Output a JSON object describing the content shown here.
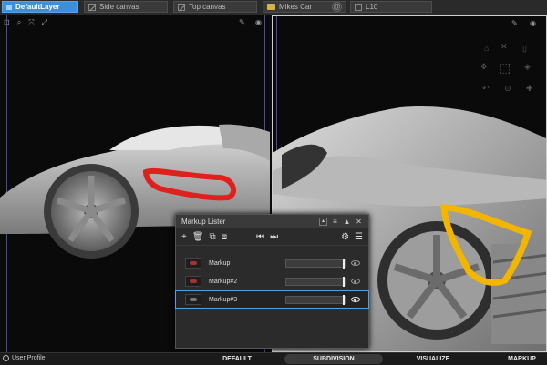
{
  "layers": [
    {
      "label": "DefaultLayer",
      "active": true,
      "icon": "layer-swatch-icon"
    },
    {
      "label": "Side canvas",
      "active": false,
      "icon": "hidden-checkbox-icon"
    },
    {
      "label": "Top canvas",
      "active": false,
      "icon": "hidden-checkbox-icon"
    },
    {
      "label": "Mikes Car",
      "active": false,
      "icon": "folder-icon"
    },
    {
      "label": "L10",
      "active": false,
      "icon": "checkbox-icon"
    }
  ],
  "viewport_icons": [
    "new-view-icon",
    "zoom-icon",
    "fit-icon",
    "expand-icon"
  ],
  "markup_lister": {
    "title": "Markup Lister",
    "toolbar": [
      "add-icon",
      "delete-icon",
      "duplicate-icon",
      "merge-icon",
      "first-icon",
      "last-icon",
      "settings-icon",
      "menu-icon"
    ],
    "rows": [
      {
        "label": "Markup",
        "selected": false,
        "visible": false
      },
      {
        "label": "Markup#2",
        "selected": false,
        "visible": false
      },
      {
        "label": "Markup#3",
        "selected": true,
        "visible": true
      }
    ]
  },
  "bottom": {
    "user_profile": "User Profile",
    "tabs": [
      "DEFAULT",
      "SUBDIVISION",
      "VISUALIZE",
      "MARKUP"
    ],
    "active_tab": "SUBDIVISION"
  },
  "colors": {
    "accent": "#3d8fd6",
    "markup_red": "#e0201c",
    "markup_yellow": "#f2b500"
  }
}
